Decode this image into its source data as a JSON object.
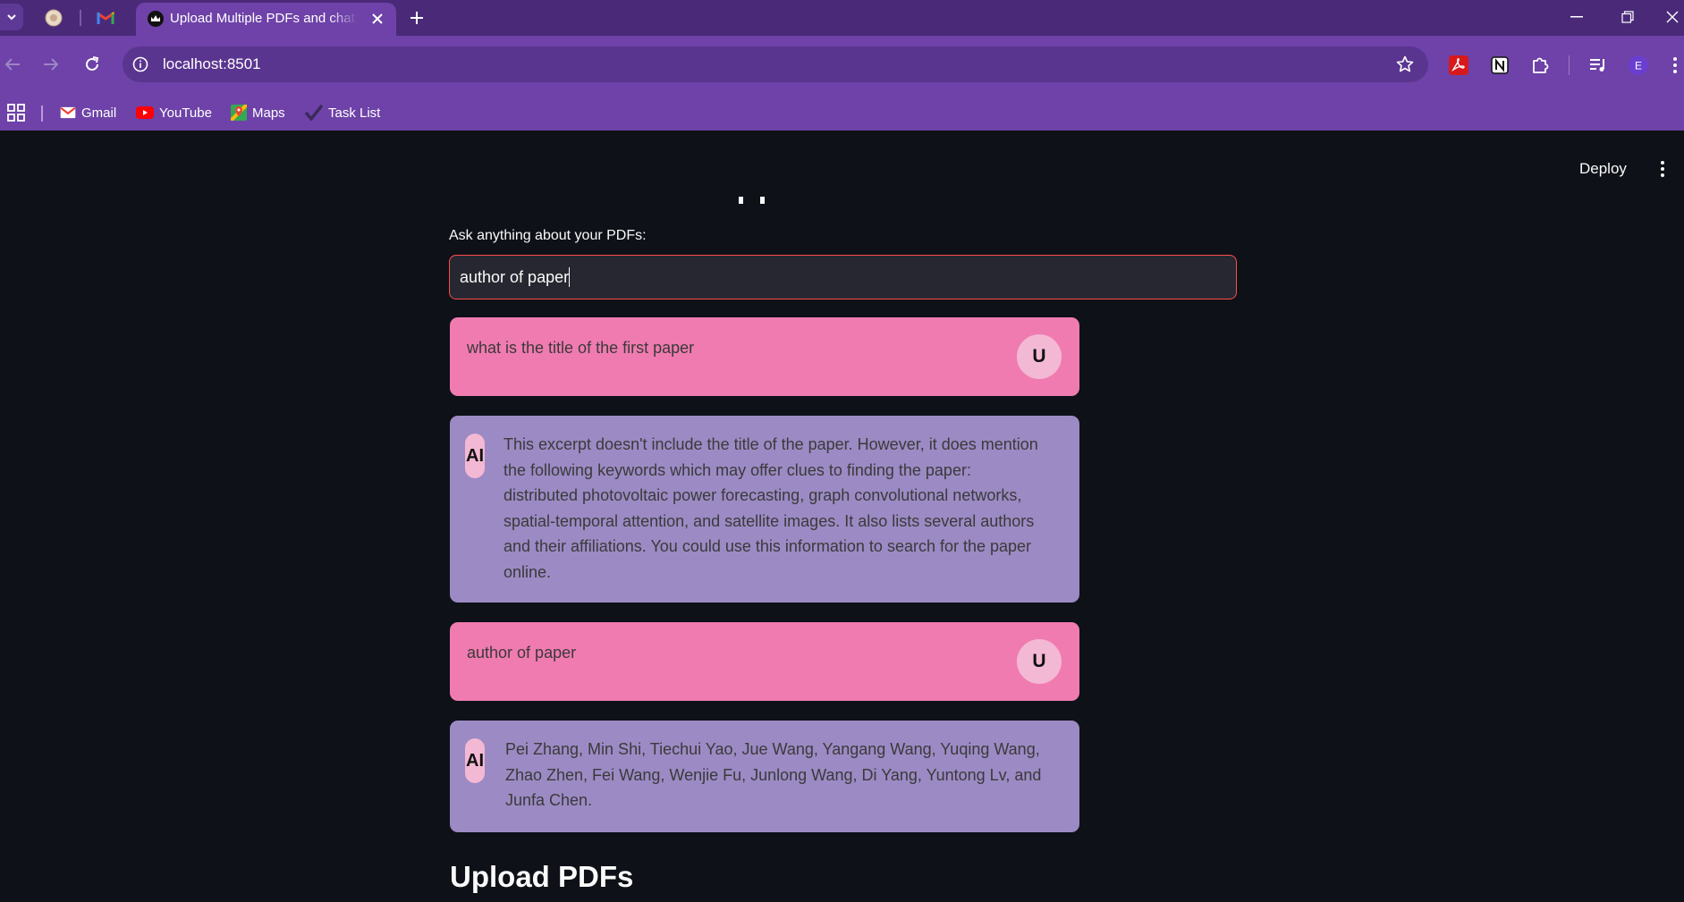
{
  "browser": {
    "active_tab_title": "Upload Multiple PDFs and chat",
    "url": "localhost:8501",
    "profile_initial": "E",
    "bookmarks": [
      {
        "label": "Gmail"
      },
      {
        "label": "YouTube"
      },
      {
        "label": "Maps"
      },
      {
        "label": "Task List"
      }
    ]
  },
  "app": {
    "deploy_label": "Deploy",
    "input_label": "Ask anything about your PDFs:",
    "input_value": "author of paper",
    "messages": [
      {
        "role": "user",
        "avatar": "U",
        "text": "what is the title of the first paper"
      },
      {
        "role": "ai",
        "avatar": "AI",
        "text": "This excerpt doesn't include the title of the paper. However, it does mention the following keywords which may offer clues to finding the paper: distributed photovoltaic power forecasting, graph convolutional networks, spatial-temporal attention, and satellite images. It also lists several authors and their affiliations. You could use this information to search for the paper online."
      },
      {
        "role": "user",
        "avatar": "U",
        "text": "author of paper"
      },
      {
        "role": "ai",
        "avatar": "AI",
        "text": "Pei Zhang, Min Shi, Tiechui Yao, Jue Wang, Yangang Wang, Yuqing Wang, Zhao Zhen, Fei Wang, Wenjie Fu, Junlong Wang, Di Yang, Yuntong Lv, and Junfa Chen."
      }
    ],
    "upload_heading": "Upload PDFs"
  },
  "colors": {
    "tabbar": "#4a2a78",
    "toolbar": "#6e42a8",
    "app_bg": "#0e1117",
    "user_bubble": "#f07bb0",
    "ai_bubble": "#9c8ac4",
    "avatar_bg": "#f3b8d4",
    "input_border": "#ff4b4b"
  }
}
